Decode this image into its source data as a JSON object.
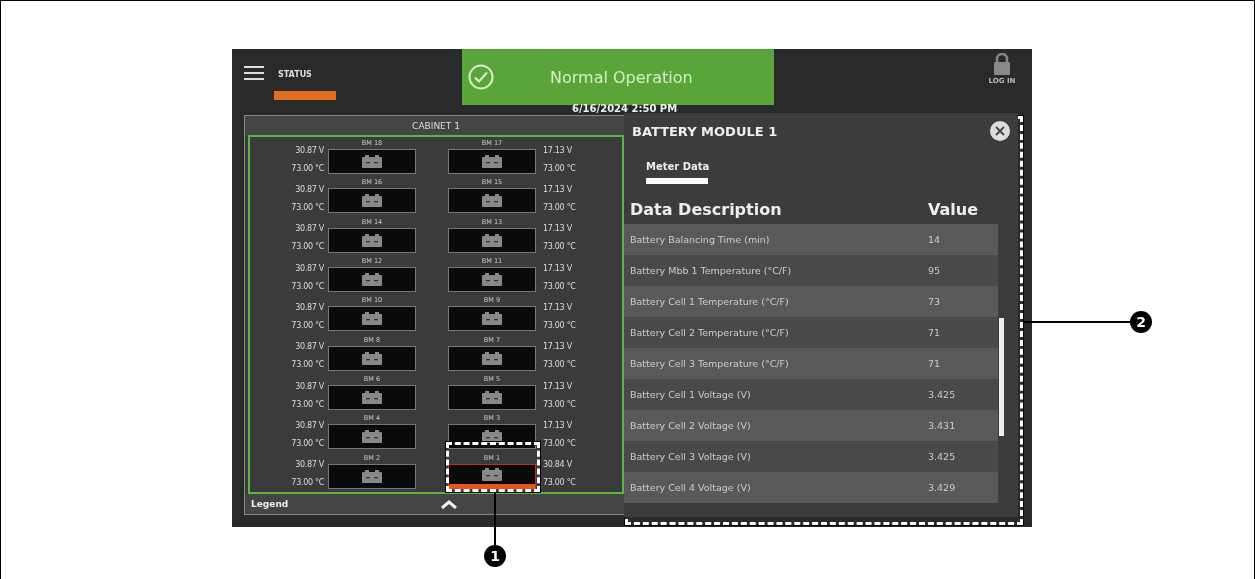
{
  "header": {
    "menu_label": "STATUS",
    "status": "Normal Operation",
    "login": "LOG IN",
    "datetime": "6/16/2024 2:50 PM"
  },
  "cabinet": {
    "title": "CABINET 1",
    "legend": "Legend",
    "rows": [
      {
        "left": {
          "label": "BM 18",
          "voltage": "30.87 V",
          "temp": "73.00 °C",
          "selected": false
        },
        "right": {
          "label": "BM 17",
          "voltage": "17.13 V",
          "temp": "73.00 °C",
          "selected": false
        }
      },
      {
        "left": {
          "label": "BM 16",
          "voltage": "30.87 V",
          "temp": "73.00 °C",
          "selected": false
        },
        "right": {
          "label": "BM 15",
          "voltage": "17.13 V",
          "temp": "73.00 °C",
          "selected": false
        }
      },
      {
        "left": {
          "label": "BM 14",
          "voltage": "30.87 V",
          "temp": "73.00 °C",
          "selected": false
        },
        "right": {
          "label": "BM 13",
          "voltage": "17.13 V",
          "temp": "73.00 °C",
          "selected": false
        }
      },
      {
        "left": {
          "label": "BM 12",
          "voltage": "30.87 V",
          "temp": "73.00 °C",
          "selected": false
        },
        "right": {
          "label": "BM 11",
          "voltage": "17.13 V",
          "temp": "73.00 °C",
          "selected": false
        }
      },
      {
        "left": {
          "label": "BM 10",
          "voltage": "30.87 V",
          "temp": "73.00 °C",
          "selected": false
        },
        "right": {
          "label": "BM 9",
          "voltage": "17.13 V",
          "temp": "73.00 °C",
          "selected": false
        }
      },
      {
        "left": {
          "label": "BM 8",
          "voltage": "30.87 V",
          "temp": "73.00 °C",
          "selected": false
        },
        "right": {
          "label": "BM 7",
          "voltage": "17.13 V",
          "temp": "73.00 °C",
          "selected": false
        }
      },
      {
        "left": {
          "label": "BM 6",
          "voltage": "30.87 V",
          "temp": "73.00 °C",
          "selected": false
        },
        "right": {
          "label": "BM 5",
          "voltage": "17.13 V",
          "temp": "73.00 °C",
          "selected": false
        }
      },
      {
        "left": {
          "label": "BM 4",
          "voltage": "30.87 V",
          "temp": "73.00 °C",
          "selected": false
        },
        "right": {
          "label": "BM 3",
          "voltage": "17.13 V",
          "temp": "73.00 °C",
          "selected": false
        }
      },
      {
        "left": {
          "label": "BM 2",
          "voltage": "30.87 V",
          "temp": "73.00 °C",
          "selected": false
        },
        "right": {
          "label": "BM 1",
          "voltage": "30.84 V",
          "temp": "73.00 °C",
          "selected": true
        }
      }
    ]
  },
  "detail": {
    "title": "BATTERY MODULE 1",
    "tabs": [
      {
        "label": "Meter Data",
        "selected": true
      }
    ],
    "columns": [
      "Data Description",
      "Value"
    ],
    "rows": [
      {
        "description": "Battery Balancing Time (min)",
        "value": "14"
      },
      {
        "description": "Battery Mbb 1 Temperature (°C/F)",
        "value": "95"
      },
      {
        "description": "Battery Cell 1 Temperature (°C/F)",
        "value": "73"
      },
      {
        "description": "Battery Cell 2 Temperature (°C/F)",
        "value": "71"
      },
      {
        "description": "Battery Cell 3 Temperature (°C/F)",
        "value": "71"
      },
      {
        "description": "Battery Cell 1 Voltage (V)",
        "value": "3.425"
      },
      {
        "description": "Battery Cell 2 Voltage (V)",
        "value": "3.431"
      },
      {
        "description": "Battery Cell 3 Voltage (V)",
        "value": "3.425"
      },
      {
        "description": "Battery Cell 4 Voltage (V)",
        "value": "3.429"
      }
    ]
  },
  "callouts": [
    {
      "number": "1"
    },
    {
      "number": "2"
    }
  ]
}
